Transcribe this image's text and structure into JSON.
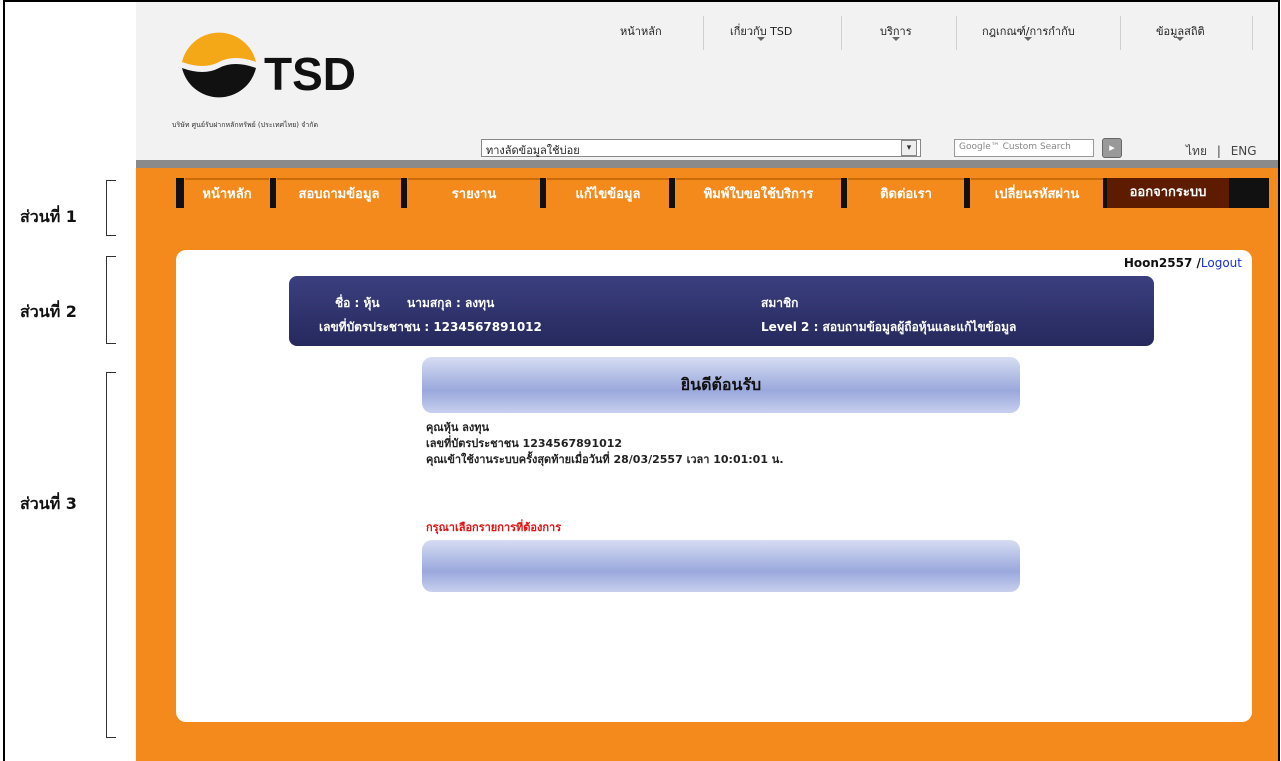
{
  "annotations": [
    "ส่วนที่ 1",
    "ส่วนที่ 2",
    "ส่วนที่ 3"
  ],
  "header": {
    "logo_text": "TSD",
    "company_name": "บริษัท ศูนย์รับฝากหลักทรัพย์ (ประเทศไทย) จำกัด",
    "top_nav": [
      "หน้าหลัก",
      "เกี่ยวกับ TSD",
      "บริการ",
      "กฎเกณฑ์/การกำกับ",
      "ข้อมูลสถิติ"
    ],
    "quick_links_value": "ทางลัดข้อมูลใช้บ่อย",
    "search_placeholder": "Google™ Custom Search",
    "lang_thai": "ไทย",
    "lang_sep": "|",
    "lang_eng": "ENG"
  },
  "menu": [
    "หน้าหลัก",
    "สอบถามข้อมูล",
    "รายงาน",
    "แก้ไขข้อมูล",
    "พิมพ์ใบขอใช้บริการ",
    "ติดต่อเรา",
    "เปลี่ยนรหัสผ่าน",
    "ออกจากระบบ"
  ],
  "user": {
    "username": "Hoon2557",
    "logout": "Logout",
    "name_label": "ชื่อ : หุ้น",
    "surname_label": "นามสกุล : ลงทุน",
    "id_label": "เลขที่บัตรประชาชน : 1234567891012",
    "role": "สมาชิก",
    "level": "Level  2   :  สอบถามข้อมูลผู้ถือหุ้นและแก้ไขข้อมูล"
  },
  "welcome": {
    "title": "ยินดีต้อนรับ",
    "line1": "คุณหุ้น ลงทุน",
    "line2": "เลขที่บัตรประชาชน 1234567891012",
    "line3": "คุณเข้าใช้งานระบบครั้งสุดท้ายเมื่อวันที่ 28/03/2557 เวลา 10:01:01 น.",
    "prompt": "กรุณาเลือกรายการที่ต้องการ"
  },
  "colors": {
    "orange": "#f48a1c",
    "navy": "#2e316c",
    "link": "#1a33cc",
    "alert": "#e01010"
  }
}
